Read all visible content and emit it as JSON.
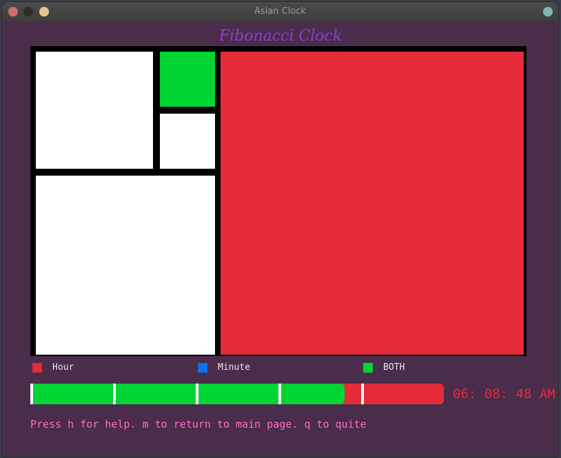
{
  "window": {
    "title": "Asian Clock"
  },
  "app": {
    "title": "Fibonacci Clock"
  },
  "colors": {
    "hour": "#e52b39",
    "minute": "#1070f0",
    "both": "#00d535",
    "off": "#ffffff",
    "background": "#4a2c4b"
  },
  "fibonacci_squares": [
    {
      "size": 1,
      "state": "both"
    },
    {
      "size": 1,
      "state": "off"
    },
    {
      "size": 2,
      "state": "off"
    },
    {
      "size": 3,
      "state": "off"
    },
    {
      "size": 5,
      "state": "hour"
    }
  ],
  "legend": [
    {
      "label": "Hour",
      "color": "#e52b39"
    },
    {
      "label": "Minute",
      "color": "#1070f0"
    },
    {
      "label": "BOTH",
      "color": "#00d535"
    }
  ],
  "progress": {
    "fraction": 0.76,
    "segments": 5
  },
  "time": "06: 08: 48 AM",
  "help_text": "Press h for help. m to return to main page. q to quite"
}
